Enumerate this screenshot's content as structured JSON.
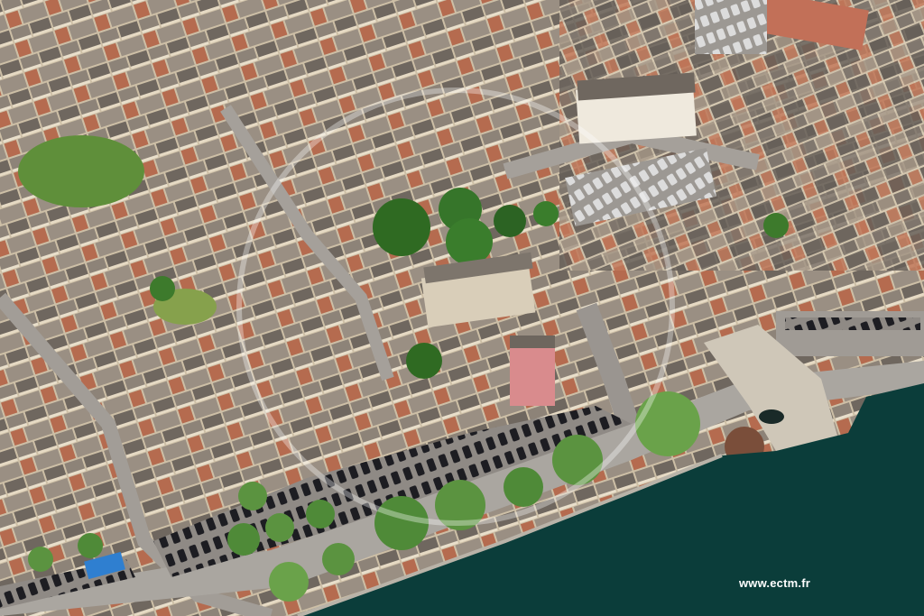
{
  "photo": {
    "subject": "aerial-view-town-riverside",
    "credit": "www.ectm.fr",
    "watermark": "ECTM",
    "colors": {
      "river": "#0b3d3a",
      "roofs_grey": "#8a7f74",
      "roofs_red": "#b86a4e",
      "walls_cream": "#e4d7bf",
      "trees": "#3f7d2b",
      "road": "#9a9590",
      "credit_text": "#ffffff"
    }
  }
}
